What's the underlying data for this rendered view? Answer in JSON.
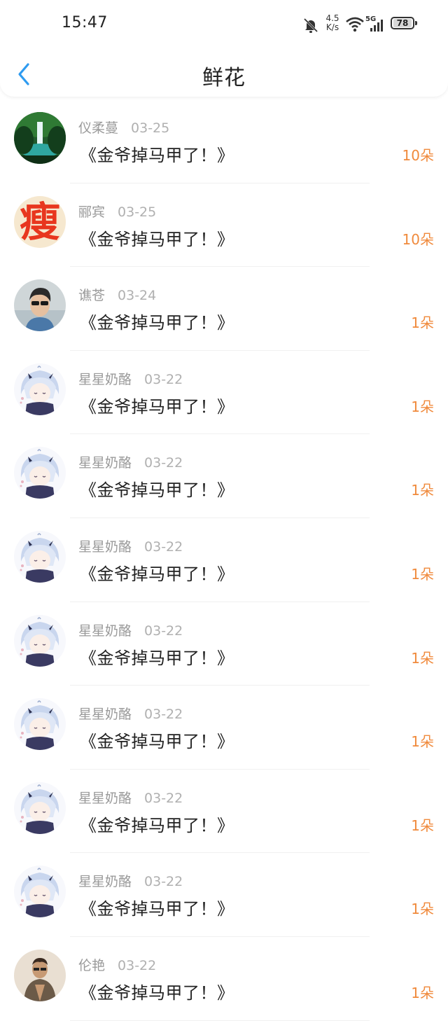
{
  "status_bar": {
    "time": "15:47",
    "net_speed_value": "4.5",
    "net_speed_unit": "K/s",
    "signal_label": "5G",
    "battery": "78",
    "icons": [
      "bell-off-icon",
      "wifi-icon",
      "signal-icon",
      "battery-icon"
    ]
  },
  "header": {
    "title": "鲜花",
    "back_icon": "chevron-left-icon"
  },
  "colors": {
    "accent": "#2e9bf0",
    "count": "#f08a3c",
    "name": "#9a9a9a",
    "title": "#222222"
  },
  "rows": [
    {
      "name": "仪柔蔓",
      "date": "03-25",
      "book": "《金爷掉马甲了！》",
      "count": "10朵",
      "avatar": "waterfall"
    },
    {
      "name": "郦宾",
      "date": "03-25",
      "book": "《金爷掉马甲了！》",
      "count": "10朵",
      "avatar": "text-glyph",
      "avatar_text": "瘦"
    },
    {
      "name": "谯苍",
      "date": "03-24",
      "book": "《金爷掉马甲了！》",
      "count": "1朵",
      "avatar": "man-sunglasses"
    },
    {
      "name": "星星奶酪",
      "date": "03-22",
      "book": "《金爷掉马甲了！》",
      "count": "1朵",
      "avatar": "anime-girl"
    },
    {
      "name": "星星奶酪",
      "date": "03-22",
      "book": "《金爷掉马甲了！》",
      "count": "1朵",
      "avatar": "anime-girl"
    },
    {
      "name": "星星奶酪",
      "date": "03-22",
      "book": "《金爷掉马甲了！》",
      "count": "1朵",
      "avatar": "anime-girl"
    },
    {
      "name": "星星奶酪",
      "date": "03-22",
      "book": "《金爷掉马甲了！》",
      "count": "1朵",
      "avatar": "anime-girl"
    },
    {
      "name": "星星奶酪",
      "date": "03-22",
      "book": "《金爷掉马甲了！》",
      "count": "1朵",
      "avatar": "anime-girl"
    },
    {
      "name": "星星奶酪",
      "date": "03-22",
      "book": "《金爷掉马甲了！》",
      "count": "1朵",
      "avatar": "anime-girl"
    },
    {
      "name": "星星奶酪",
      "date": "03-22",
      "book": "《金爷掉马甲了！》",
      "count": "1朵",
      "avatar": "anime-girl"
    },
    {
      "name": "伦艳",
      "date": "03-22",
      "book": "《金爷掉马甲了！》",
      "count": "1朵",
      "avatar": "man-portrait"
    }
  ]
}
